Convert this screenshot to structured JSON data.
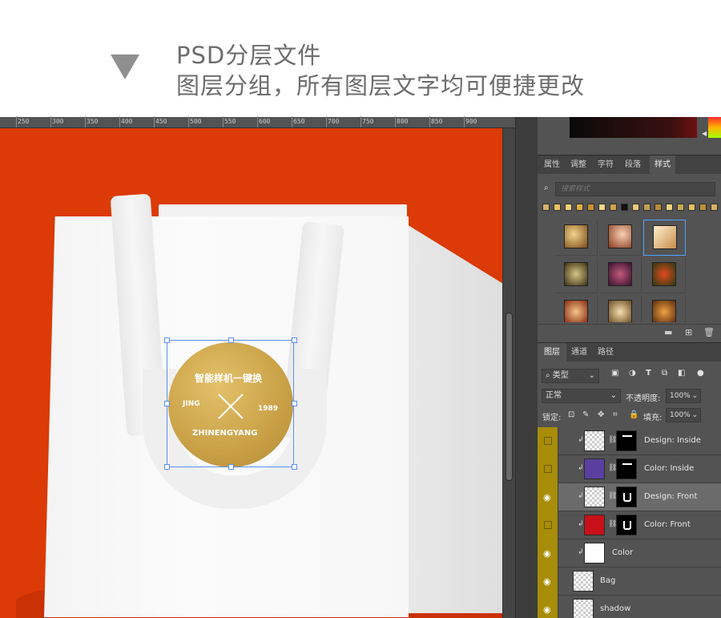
{
  "header": {
    "line1": "PSD分层文件",
    "line2": "图层分组，所有图层文字均可便捷更改"
  },
  "ruler": {
    "labels": [
      "250",
      "300",
      "350",
      "400",
      "450",
      "500",
      "550",
      "600",
      "650",
      "700",
      "750",
      "800",
      "850",
      "900"
    ]
  },
  "sticker": {
    "top_text": "智能样机一键换",
    "left_text": "JING",
    "right_text": "1989",
    "bottom_text": "ZHINENGYANG"
  },
  "panel": {
    "tabs": [
      "属性",
      "调整",
      "字符",
      "段落",
      "样式"
    ],
    "active_tab": "样式",
    "search_placeholder": "搜索样式",
    "layer_tabs": [
      "图层",
      "通道",
      "路径"
    ],
    "active_layer_tab": "图层",
    "kind_label": "类型",
    "blend_mode": "正常",
    "opacity_label": "不透明度:",
    "opacity_value": "100%",
    "lock_label": "锁定:",
    "fill_label": "填充:",
    "fill_value": "100%"
  },
  "layers": [
    {
      "name": "Design: Inside",
      "visible": false,
      "thumb": "checker",
      "mask": "line"
    },
    {
      "name": "Color: Inside",
      "visible": false,
      "thumb": "#5a3fa0",
      "mask": "line"
    },
    {
      "name": "Design: Front",
      "visible": true,
      "thumb": "checker",
      "mask": "u",
      "highlighted": true
    },
    {
      "name": "Color: Front",
      "visible": false,
      "thumb": "#c8101a",
      "mask": "u"
    },
    {
      "name": "Color",
      "visible": true,
      "thumb": "#ffffff",
      "mask": "none"
    },
    {
      "name": "Bag",
      "visible": true,
      "thumb": "checker",
      "mask": "none"
    },
    {
      "name": "shadow",
      "visible": true,
      "thumb": "checker",
      "mask": "none"
    }
  ],
  "colors": {
    "canvas_bg": "#dc3a06",
    "panel_bg": "#535353",
    "eye_column": "#a88d0a",
    "selection": "#5b8ef0"
  }
}
